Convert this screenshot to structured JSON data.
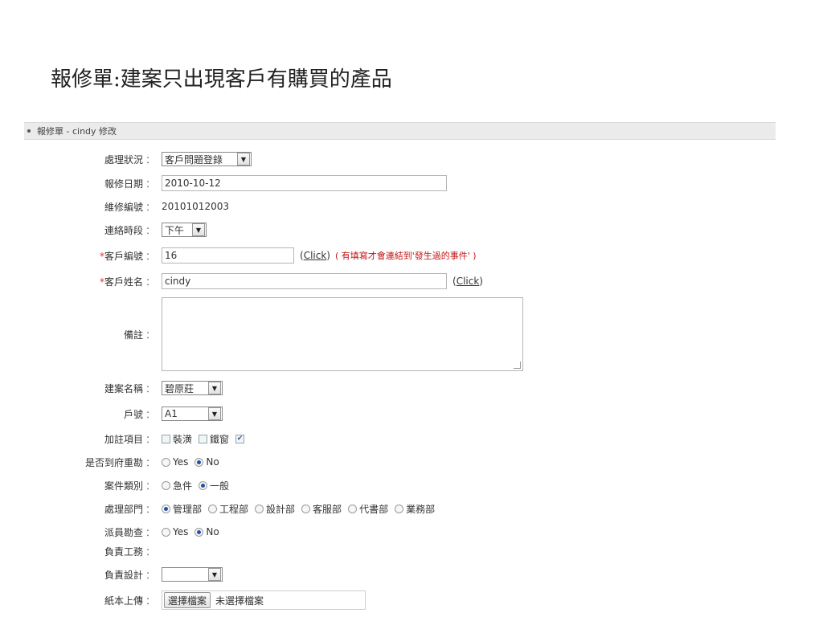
{
  "page": {
    "title": "報修單:建案只出現客戶有購買的產品"
  },
  "panel": {
    "header": "報修單 - cindy 修改"
  },
  "form": {
    "status": {
      "label": "處理狀況",
      "value": "客戶問題登錄"
    },
    "repair_date": {
      "label": "報修日期",
      "value": "2010-10-12"
    },
    "repair_no": {
      "label": "維修編號",
      "value": "20101012003"
    },
    "contact_time": {
      "label": "連絡時段",
      "value": "下午"
    },
    "customer_no": {
      "label": "客戶編號",
      "value": "16",
      "link": "Click",
      "note": "( 有填寫才會連結到'發生過的事件' )",
      "required_mark": "*"
    },
    "customer_name": {
      "label": "客戶姓名",
      "value": "cindy",
      "link": "Click",
      "required_mark": "*"
    },
    "remarks": {
      "label": "備註",
      "value": ""
    },
    "project_name": {
      "label": "建案名稱",
      "value": "碧原莊"
    },
    "unit_no": {
      "label": "戶號",
      "value": "A1"
    },
    "extra_items": {
      "label": "加註項目",
      "options": [
        {
          "label": "裝潢",
          "checked": false
        },
        {
          "label": "鐵窗",
          "checked": false
        },
        {
          "label": "",
          "checked": true
        }
      ]
    },
    "onsite_survey": {
      "label": "是否到府重勘",
      "options": [
        {
          "label": "Yes",
          "selected": false
        },
        {
          "label": "No",
          "selected": true
        }
      ]
    },
    "case_type": {
      "label": "案件類別",
      "options": [
        {
          "label": "急件",
          "selected": false
        },
        {
          "label": "一般",
          "selected": true
        }
      ]
    },
    "department": {
      "label": "處理部門",
      "options": [
        {
          "label": "管理部",
          "selected": true
        },
        {
          "label": "工程部",
          "selected": false
        },
        {
          "label": "設計部",
          "selected": false
        },
        {
          "label": "客服部",
          "selected": false
        },
        {
          "label": "代書部",
          "selected": false
        },
        {
          "label": "業務部",
          "selected": false
        }
      ]
    },
    "dispatch_survey": {
      "label": "派員勘查",
      "options": [
        {
          "label": "Yes",
          "selected": false
        },
        {
          "label": "No",
          "selected": true
        }
      ]
    },
    "responsible_work": {
      "label": "負責工務"
    },
    "responsible_design": {
      "label": "負責設計",
      "value": ""
    },
    "paper_upload": {
      "label": "紙本上傳",
      "button": "選擇檔案",
      "status": "未選擇檔案"
    },
    "colon": "："
  }
}
